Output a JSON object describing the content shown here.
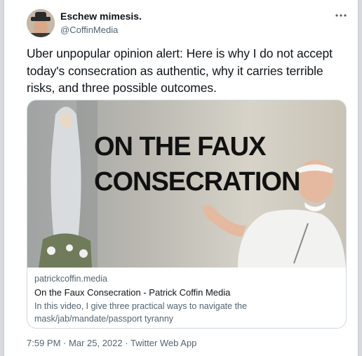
{
  "author": {
    "display_name": "Eschew mimesis.",
    "handle": "@CoffinMedia"
  },
  "tweet": {
    "text": "Uber unpopular opinion alert: Here is why I do not accept today's consecration as authentic, why it carries terrible risks, and three possible outcomes."
  },
  "card": {
    "image_title_line1": "ON THE FAUX",
    "image_title_line2": "CONSECRATION",
    "domain": "patrickcoffin.media",
    "title": "On the Faux Consecration - Patrick Coffin Media",
    "description": "In this video, I give three practical ways to navigate the mask/jab/mandate/passport tyranny"
  },
  "footer": {
    "time": "7:59 PM",
    "separator1": "·",
    "date": "Mar 25, 2022",
    "separator2": "·",
    "source": "Twitter Web App"
  },
  "icons": {
    "more": "more-horizontal-icon"
  }
}
